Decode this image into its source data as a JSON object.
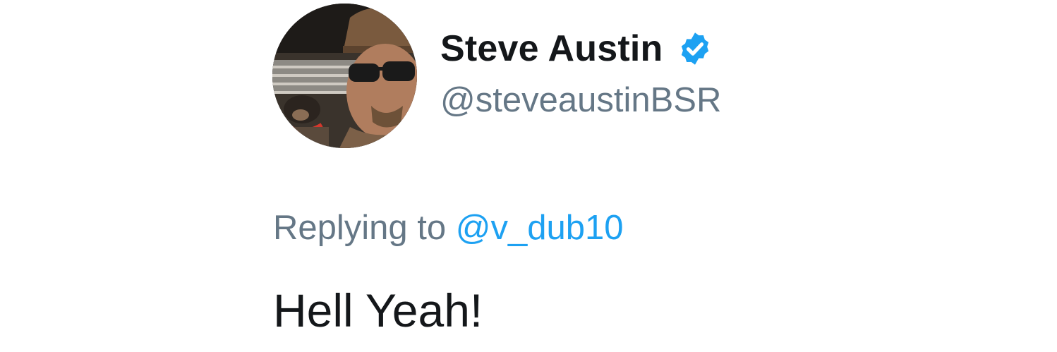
{
  "tweet": {
    "author": {
      "display_name": "Steve Austin",
      "handle": "@steveaustinBSR",
      "verified": true,
      "avatar": "profile-photo"
    },
    "reply": {
      "prefix": "Replying to",
      "mention": "@v_dub10"
    },
    "text": "Hell Yeah!"
  },
  "colors": {
    "text_primary": "#14171a",
    "text_secondary": "#657786",
    "link": "#1da1f2",
    "verified_badge": "#1da1f2"
  }
}
